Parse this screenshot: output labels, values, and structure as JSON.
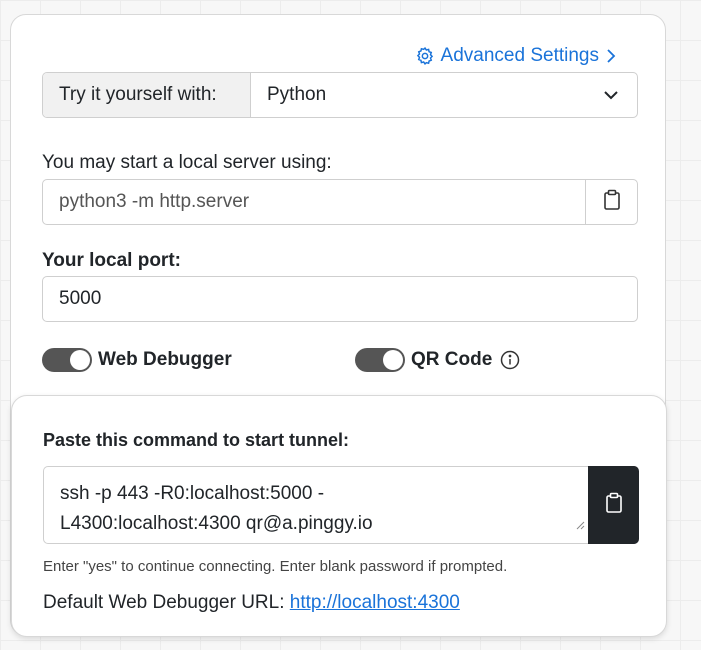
{
  "header": {
    "advanced_settings_label": "Advanced Settings"
  },
  "try_row": {
    "label": "Try it yourself with:",
    "selected_language": "Python"
  },
  "server": {
    "label": "You may start a local server using:",
    "command": "python3 -m http.server"
  },
  "port": {
    "label": "Your local port:",
    "value": "5000"
  },
  "toggles": {
    "web_debugger_label": "Web Debugger",
    "web_debugger_on": true,
    "qr_code_label": "QR Code",
    "qr_code_on": true
  },
  "tunnel": {
    "title": "Paste this command to start tunnel:",
    "command_line1": "ssh -p 443 -R0:localhost:5000 -",
    "command_line2": "L4300:localhost:4300 qr@a.pinggy.io",
    "hint": "Enter \"yes\" to continue connecting. Enter blank password if prompted.",
    "debugger_url_label": "Default Web Debugger URL:",
    "debugger_url": "http://localhost:4300"
  },
  "colors": {
    "accent": "#1a73d9",
    "toggle_on": "#555555",
    "copy_button_dark": "#212529"
  },
  "icons": {
    "settings": "gear-icon",
    "advance": "chevron-right-icon",
    "dropdown": "chevron-down-icon",
    "copy": "clipboard-icon",
    "info": "info-icon"
  }
}
